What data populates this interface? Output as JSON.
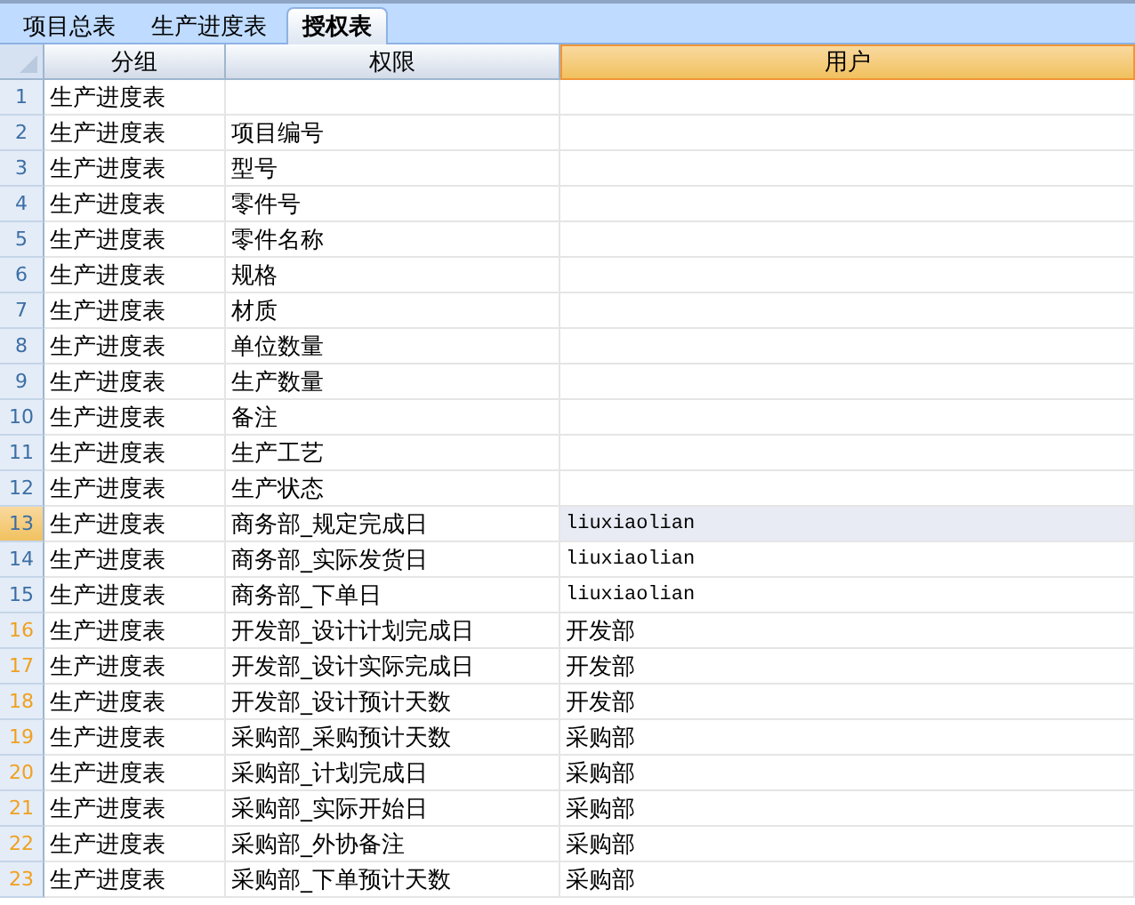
{
  "tabs": [
    {
      "label": "项目总表",
      "selected": false
    },
    {
      "label": "生产进度表",
      "selected": false
    },
    {
      "label": "授权表",
      "selected": true
    }
  ],
  "columns": [
    {
      "label": "分组",
      "selected": false
    },
    {
      "label": "权限",
      "selected": false
    },
    {
      "label": "用户",
      "selected": true
    }
  ],
  "rows": [
    {
      "number": "1",
      "group": "生产进度表",
      "permission": "",
      "user": "",
      "selected": false,
      "color": "#3b6ea5"
    },
    {
      "number": "2",
      "group": "生产进度表",
      "permission": "项目编号",
      "user": "",
      "selected": false,
      "color": "#3b6ea5"
    },
    {
      "number": "3",
      "group": "生产进度表",
      "permission": "型号",
      "user": "",
      "selected": false,
      "color": "#3b6ea5"
    },
    {
      "number": "4",
      "group": "生产进度表",
      "permission": "零件号",
      "user": "",
      "selected": false,
      "color": "#3b6ea5"
    },
    {
      "number": "5",
      "group": "生产进度表",
      "permission": "零件名称",
      "user": "",
      "selected": false,
      "color": "#3b6ea5"
    },
    {
      "number": "6",
      "group": "生产进度表",
      "permission": "规格",
      "user": "",
      "selected": false,
      "color": "#3b6ea5"
    },
    {
      "number": "7",
      "group": "生产进度表",
      "permission": "材质",
      "user": "",
      "selected": false,
      "color": "#3b6ea5"
    },
    {
      "number": "8",
      "group": "生产进度表",
      "permission": "单位数量",
      "user": "",
      "selected": false,
      "color": "#3b6ea5"
    },
    {
      "number": "9",
      "group": "生产进度表",
      "permission": "生产数量",
      "user": "",
      "selected": false,
      "color": "#3b6ea5"
    },
    {
      "number": "10",
      "group": "生产进度表",
      "permission": "备注",
      "user": "",
      "selected": false,
      "color": "#3b6ea5"
    },
    {
      "number": "11",
      "group": "生产进度表",
      "permission": "生产工艺",
      "user": "",
      "selected": false,
      "color": "#3b6ea5"
    },
    {
      "number": "12",
      "group": "生产进度表",
      "permission": "生产状态",
      "user": "",
      "selected": false,
      "color": "#3b6ea5"
    },
    {
      "number": "13",
      "group": "生产进度表",
      "permission": "商务部_规定完成日",
      "user": "liuxiaolian",
      "selected": true,
      "color": "#3b6ea5"
    },
    {
      "number": "14",
      "group": "生产进度表",
      "permission": "商务部_实际发货日",
      "user": "liuxiaolian",
      "selected": false,
      "color": "#3b6ea5"
    },
    {
      "number": "15",
      "group": "生产进度表",
      "permission": "商务部_下单日",
      "user": "liuxiaolian",
      "selected": false,
      "color": "#3b6ea5"
    },
    {
      "number": "16",
      "group": "生产进度表",
      "permission": "开发部_设计计划完成日",
      "user": "开发部",
      "selected": false,
      "color": "#f0a020"
    },
    {
      "number": "17",
      "group": "生产进度表",
      "permission": "开发部_设计实际完成日",
      "user": "开发部",
      "selected": false,
      "color": "#f0a020"
    },
    {
      "number": "18",
      "group": "生产进度表",
      "permission": "开发部_设计预计天数",
      "user": "开发部",
      "selected": false,
      "color": "#f0a020"
    },
    {
      "number": "19",
      "group": "生产进度表",
      "permission": "采购部_采购预计天数",
      "user": "采购部",
      "selected": false,
      "color": "#f0a020"
    },
    {
      "number": "20",
      "group": "生产进度表",
      "permission": "采购部_计划完成日",
      "user": "采购部",
      "selected": false,
      "color": "#f0a020"
    },
    {
      "number": "21",
      "group": "生产进度表",
      "permission": "采购部_实际开始日",
      "user": "采购部",
      "selected": false,
      "color": "#f0a020"
    },
    {
      "number": "22",
      "group": "生产进度表",
      "permission": "采购部_外协备注",
      "user": "采购部",
      "selected": false,
      "color": "#f0a020"
    },
    {
      "number": "23",
      "group": "生产进度表",
      "permission": "采购部_下单预计天数",
      "user": "采购部",
      "selected": false,
      "color": "#f0a020"
    }
  ]
}
